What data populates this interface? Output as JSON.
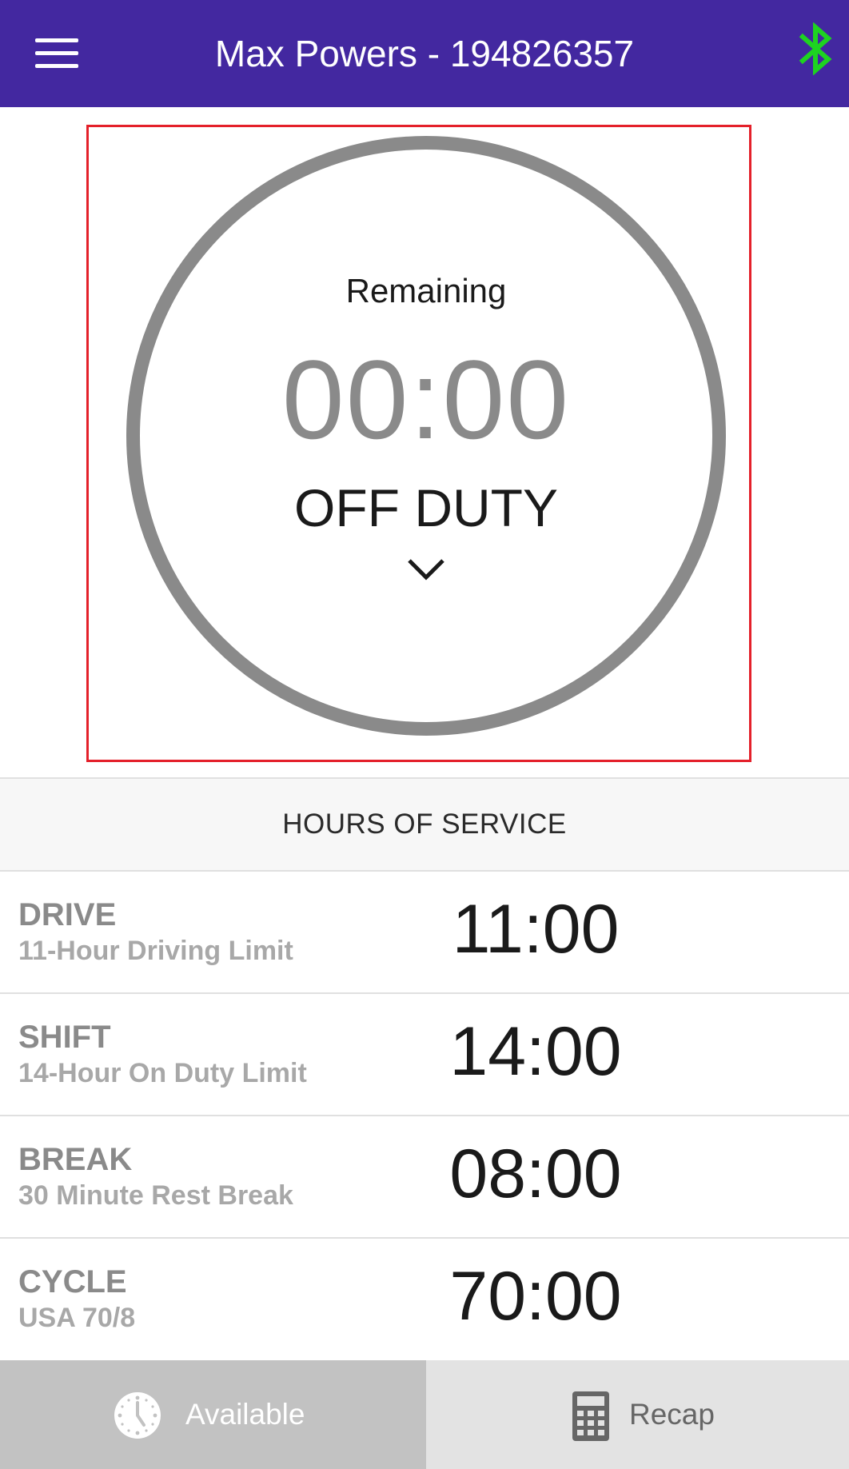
{
  "header": {
    "title": "Max Powers - 194826357",
    "menu_icon": "hamburger-menu-icon",
    "bluetooth_icon": "bluetooth-icon",
    "bluetooth_color": "#1ed321",
    "bar_color": "#4328a0"
  },
  "status": {
    "remaining_label": "Remaining",
    "timer": "00:00",
    "duty_status": "OFF DUTY",
    "dropdown_icon": "chevron-down-icon",
    "ring_color": "#8a8a8a",
    "highlight_color": "#e4202a"
  },
  "hours_of_service": {
    "title": "HOURS OF SERVICE",
    "rows": [
      {
        "name": "DRIVE",
        "description": "11-Hour Driving Limit",
        "value": "11:00"
      },
      {
        "name": "SHIFT",
        "description": "14-Hour On Duty Limit",
        "value": "14:00"
      },
      {
        "name": "BREAK",
        "description": "30 Minute Rest Break",
        "value": "08:00"
      },
      {
        "name": "CYCLE",
        "description": "USA 70/8",
        "value": "70:00"
      }
    ]
  },
  "tabs": [
    {
      "label": "Available",
      "icon": "clock-icon",
      "selected": true
    },
    {
      "label": "Recap",
      "icon": "calculator-icon",
      "selected": false
    }
  ]
}
